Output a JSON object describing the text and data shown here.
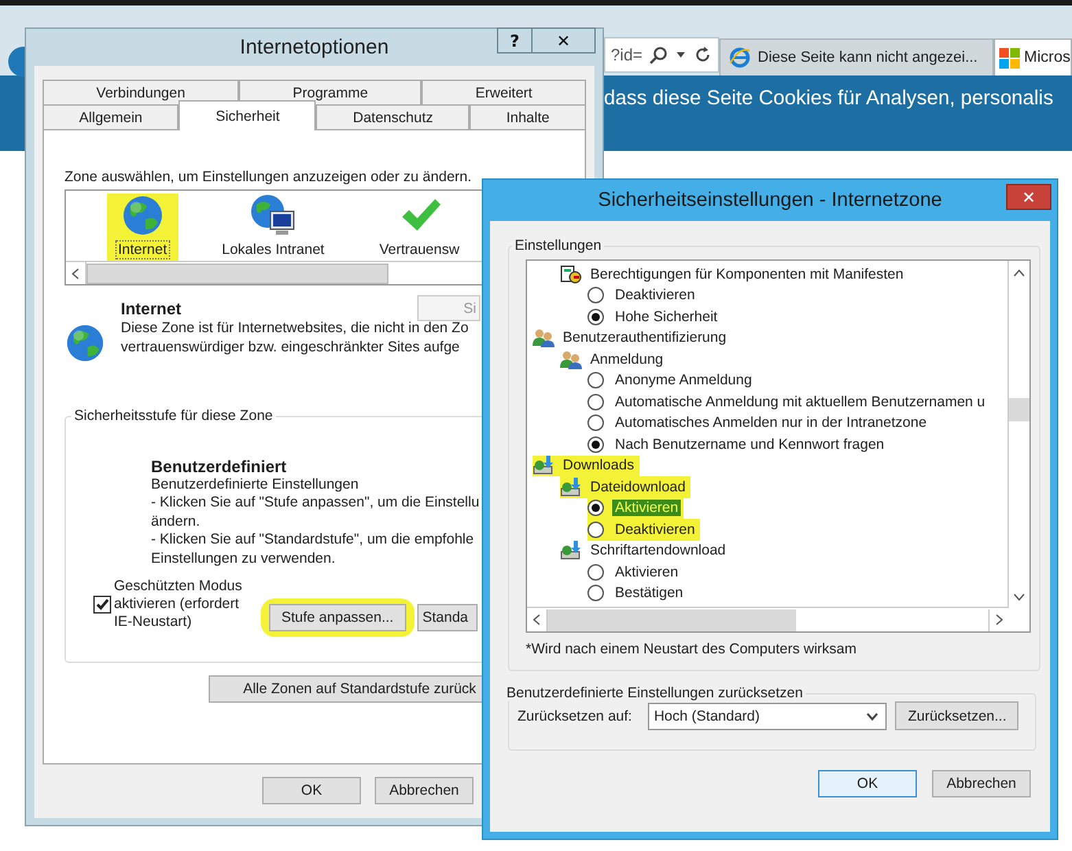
{
  "browser": {
    "address_fragment": "?id=",
    "tabs": [
      {
        "label": "Diese Seite kann nicht angezei...",
        "selected": false
      },
      {
        "label": "Micros",
        "selected": true
      }
    ],
    "banner_text": "dass diese Seite Cookies für Analysen, personalis"
  },
  "internet_options": {
    "title": "Internetoptionen",
    "help_button": "?",
    "close_button": "✕",
    "tab_rows": [
      [
        {
          "label": "Verbindungen",
          "selected": false
        },
        {
          "label": "Programme",
          "selected": false
        },
        {
          "label": "Erweitert",
          "selected": false
        }
      ],
      [
        {
          "label": "Allgemein",
          "selected": false
        },
        {
          "label": "Sicherheit",
          "selected": true
        },
        {
          "label": "Datenschutz",
          "selected": false
        },
        {
          "label": "Inhalte",
          "selected": false
        }
      ]
    ],
    "zone_prompt": "Zone auswählen, um Einstellungen anzuzeigen oder zu ändern.",
    "zones": [
      {
        "kind": "internet",
        "label": "Internet",
        "selected": true,
        "marked": true
      },
      {
        "kind": "intranet",
        "label": "Lokales Intranet",
        "selected": false,
        "marked": false
      },
      {
        "kind": "trusted",
        "label": "Vertrauensw",
        "selected": false,
        "marked": false
      }
    ],
    "zone_name": "Internet",
    "sites_button": "Si",
    "zone_description": "Diese Zone ist für Internetwebsites, die nicht in den Zo\nvertrauenswürdiger bzw. eingeschränkter Sites aufge",
    "level_group_title": "Sicherheitsstufe für diese Zone",
    "level_name": "Benutzerdefiniert",
    "level_description": "Benutzerdefinierte Einstellungen\n- Klicken Sie auf \"Stufe anpassen\", um die Einstellu\nändern.\n- Klicken Sie auf \"Standardstufe\", um die empfohle\nEinstellungen zu verwenden.",
    "protected_mode": {
      "label": "Geschützten Modus\naktivieren (erfordert\nIE-Neustart)",
      "checked": true
    },
    "custom_level_button": {
      "label": "Stufe anpassen...",
      "marked": true
    },
    "default_level_button": "Standa",
    "reset_all_button": "Alle Zonen auf Standardstufe zurück",
    "buttons": [
      "OK",
      "Abbrechen"
    ]
  },
  "security_settings": {
    "title": "Sicherheitseinstellungen - Internetzone",
    "close_button": "✕",
    "settings_group_title": "Einstellungen",
    "tree": [
      {
        "kind": "group",
        "children": [
          {
            "kind": "certificate-group",
            "label": "Berechtigungen für Komponenten mit Manifesten",
            "marked": false,
            "children": [
              {
                "kind": "radio",
                "label": "Deaktivieren",
                "checked": false,
                "selected": false,
                "marked": false
              },
              {
                "kind": "radio",
                "label": "Hohe Sicherheit",
                "checked": true,
                "selected": false,
                "marked": false
              }
            ]
          }
        ]
      },
      {
        "kind": "user-group",
        "label": "Benutzerauthentifizierung",
        "marked": false,
        "children": [
          {
            "kind": "user-group",
            "label": "Anmeldung",
            "marked": false,
            "children": [
              {
                "kind": "radio",
                "label": "Anonyme Anmeldung",
                "checked": false,
                "selected": false,
                "marked": false
              },
              {
                "kind": "radio",
                "label": "Automatische Anmeldung mit aktuellem Benutzernamen u",
                "checked": false,
                "selected": false,
                "marked": false
              },
              {
                "kind": "radio",
                "label": "Automatisches Anmelden nur in der Intranetzone",
                "checked": false,
                "selected": false,
                "marked": false
              },
              {
                "kind": "radio",
                "label": "Nach Benutzername und Kennwort fragen",
                "checked": true,
                "selected": false,
                "marked": false
              }
            ]
          }
        ]
      },
      {
        "kind": "download-group",
        "label": "Downloads",
        "marked": true,
        "children": [
          {
            "kind": "download-group",
            "label": "Dateidownload",
            "marked": true,
            "children": [
              {
                "kind": "radio",
                "label": "Aktivieren",
                "checked": true,
                "selected": true,
                "marked": true
              },
              {
                "kind": "radio",
                "label": "Deaktivieren",
                "checked": false,
                "selected": false,
                "marked": true
              }
            ]
          },
          {
            "kind": "download-group",
            "label": "Schriftartendownload",
            "marked": false,
            "children": [
              {
                "kind": "radio",
                "label": "Aktivieren",
                "checked": false,
                "selected": false,
                "marked": false
              },
              {
                "kind": "radio",
                "label": "Bestätigen",
                "checked": false,
                "selected": false,
                "marked": false
              }
            ]
          }
        ]
      }
    ],
    "footnote": "*Wird nach einem Neustart des Computers wirksam",
    "reset_group_title": "Benutzerdefinierte Einstellungen zurücksetzen",
    "reset_label": "Zurücksetzen auf:",
    "reset_select": "Hoch (Standard)",
    "reset_button": "Zurücksetzen...",
    "buttons": [
      "OK",
      "Abbrechen"
    ]
  }
}
